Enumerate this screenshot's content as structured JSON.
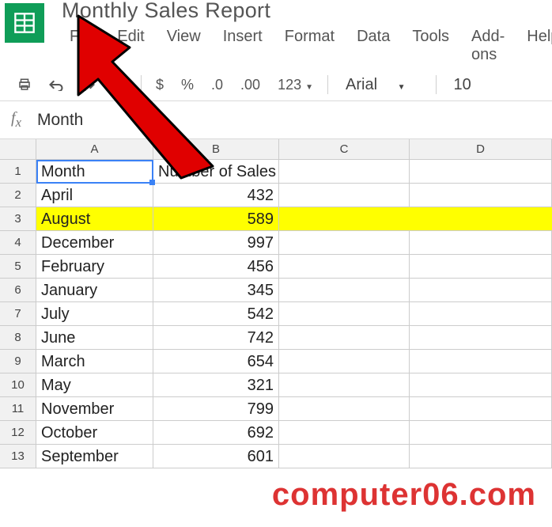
{
  "doc": {
    "title": "Monthly Sales Report"
  },
  "menu": {
    "file": "File",
    "edit": "Edit",
    "view": "View",
    "insert": "Insert",
    "format": "Format",
    "data": "Data",
    "tools": "Tools",
    "addons": "Add-ons",
    "help": "Help"
  },
  "toolbar": {
    "currency": "$",
    "percent": "%",
    "dec_dec": ".0",
    "dec_inc": ".00",
    "num_fmt": "123",
    "font": "Arial",
    "font_size": "10"
  },
  "formula_bar": {
    "value": "Month"
  },
  "columns": {
    "a": "A",
    "b": "B",
    "c": "C",
    "d": "D"
  },
  "rows_hdr": {
    "r1": "1",
    "r2": "2",
    "r3": "3",
    "r4": "4",
    "r5": "5",
    "r6": "6",
    "r7": "7",
    "r8": "8",
    "r9": "9",
    "r10": "10",
    "r11": "11",
    "r12": "12",
    "r13": "13"
  },
  "cells": {
    "a1": "Month",
    "b1": "Number of Sales",
    "a2": "April",
    "b2": "432",
    "a3": "August",
    "b3": "589",
    "a4": "December",
    "b4": "997",
    "a5": "February",
    "b5": "456",
    "a6": "January",
    "b6": "345",
    "a7": "July",
    "b7": "542",
    "a8": "June",
    "b8": "742",
    "a9": "March",
    "b9": "654",
    "a10": "May",
    "b10": "321",
    "a11": "November",
    "b11": "799",
    "a12": "October",
    "b12": "692",
    "a13": "September",
    "b13": "601"
  },
  "highlighted_row": 3,
  "watermark": "computer06.com"
}
